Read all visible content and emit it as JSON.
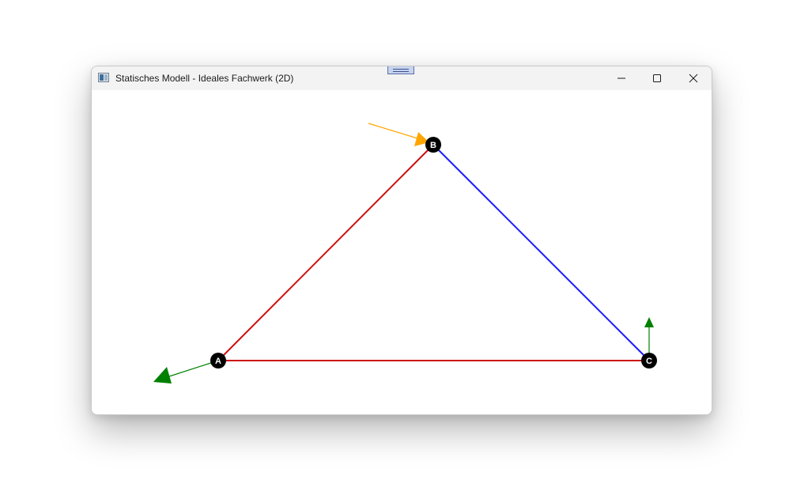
{
  "window": {
    "title": "Statisches Modell - Ideales Fachwerk (2D)",
    "icon": "app-window-icon",
    "controls": {
      "minimize_icon": "minimize-icon",
      "maximize_icon": "maximize-icon",
      "close_icon": "close-icon"
    }
  },
  "model": {
    "nodes": [
      {
        "id": "A",
        "label": "A"
      },
      {
        "id": "B",
        "label": "B"
      },
      {
        "id": "C",
        "label": "C"
      }
    ],
    "members": [
      {
        "from": "A",
        "to": "B",
        "color": "#cc1010"
      },
      {
        "from": "B",
        "to": "C",
        "color": "#1a1aff"
      },
      {
        "from": "A",
        "to": "C",
        "color": "#cc1010"
      }
    ],
    "load_color": "#ffa500",
    "reaction_color": "#008000"
  }
}
